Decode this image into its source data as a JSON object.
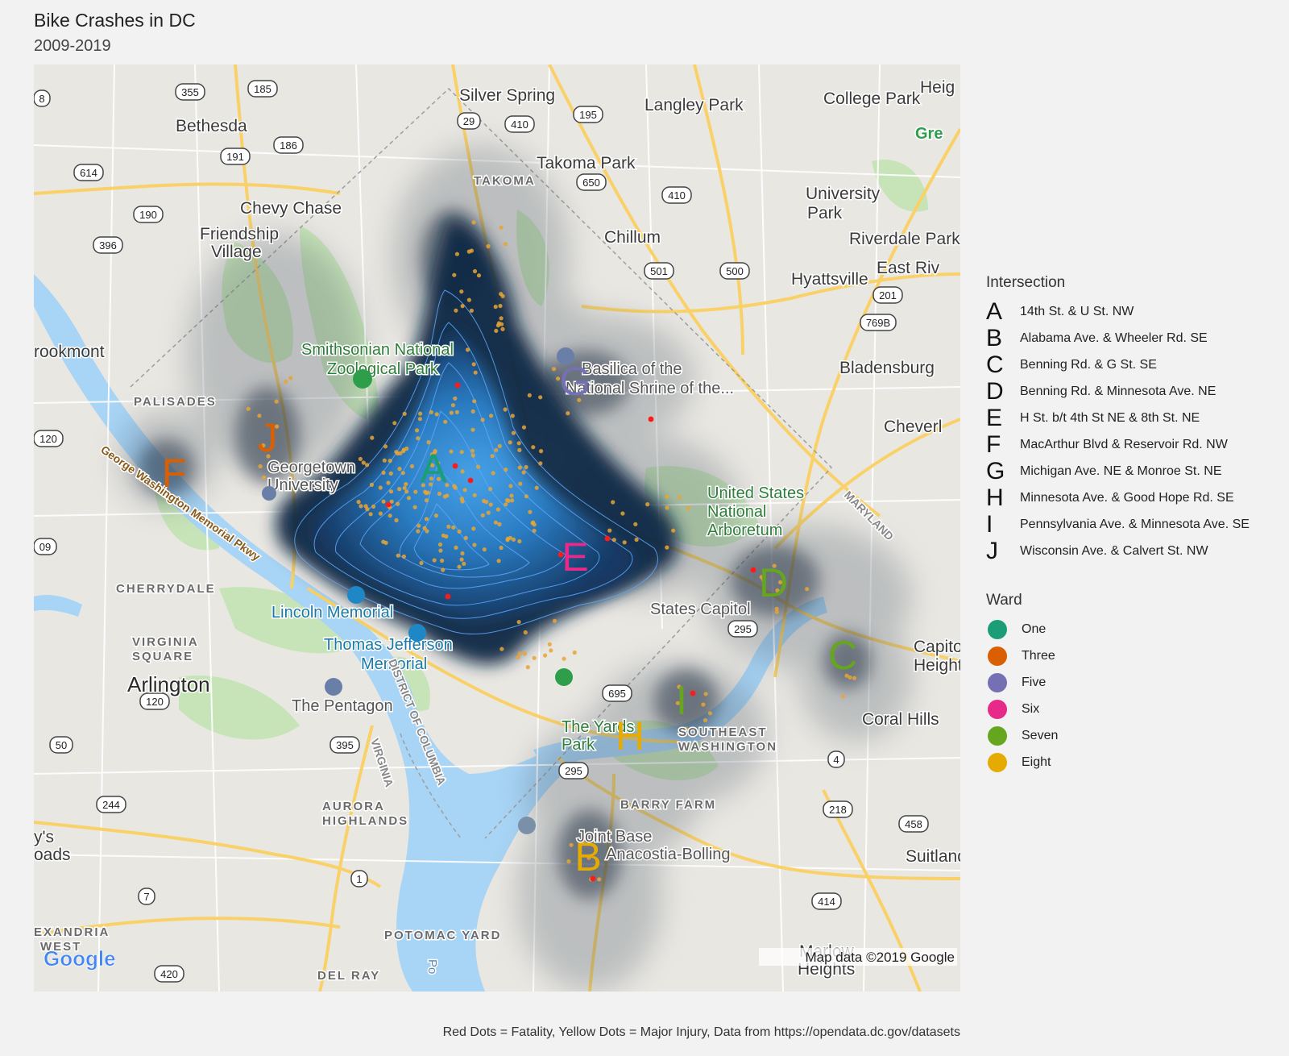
{
  "title": "Bike Crashes in DC",
  "subtitle": "2009-2019",
  "caption": "Red Dots = Fatality, Yellow Dots = Major Injury, Data from https://opendata.dc.gov/datasets",
  "map": {
    "copyright": "Map data ©2019 Google",
    "logo": "Google",
    "place_labels": [
      {
        "text": "Silver Spring",
        "kind": "city"
      },
      {
        "text": "Langley Park",
        "kind": "city"
      },
      {
        "text": "College Park",
        "kind": "city"
      },
      {
        "text": "Bethesda",
        "kind": "city"
      },
      {
        "text": "Takoma Park",
        "kind": "city"
      },
      {
        "text": "TAKOMA",
        "kind": "nbhd"
      },
      {
        "text": "Chevy Chase",
        "kind": "city"
      },
      {
        "text": "University",
        "kind": "city"
      },
      {
        "text": "Park",
        "kind": "city"
      },
      {
        "text": "Friendship",
        "kind": "city"
      },
      {
        "text": "Village",
        "kind": "city"
      },
      {
        "text": "Chillum",
        "kind": "city"
      },
      {
        "text": "Riverdale Park",
        "kind": "city"
      },
      {
        "text": "Hyattsville",
        "kind": "city"
      },
      {
        "text": "East Riv",
        "kind": "city"
      },
      {
        "text": "rookmont",
        "kind": "city"
      },
      {
        "text": "Smithsonian National",
        "kind": "park"
      },
      {
        "text": "Zoological Park",
        "kind": "park"
      },
      {
        "text": "Basilica of the",
        "kind": "poi"
      },
      {
        "text": "National Shrine of the...",
        "kind": "poi"
      },
      {
        "text": "Bladensburg",
        "kind": "city"
      },
      {
        "text": "PALISADES",
        "kind": "nbhd"
      },
      {
        "text": "Cheverl",
        "kind": "city"
      },
      {
        "text": "Georgetown",
        "kind": "poi"
      },
      {
        "text": "University",
        "kind": "poi"
      },
      {
        "text": "United States",
        "kind": "park"
      },
      {
        "text": "National",
        "kind": "park"
      },
      {
        "text": "Arboretum",
        "kind": "park"
      },
      {
        "text": "CHERRYDALE",
        "kind": "nbhd"
      },
      {
        "text": "Lincoln Memorial",
        "kind": "poiblue"
      },
      {
        "text": "States Capitol",
        "kind": "poi"
      },
      {
        "text": "Thomas Jefferson",
        "kind": "poiblue"
      },
      {
        "text": "Memorial",
        "kind": "poiblue"
      },
      {
        "text": "VIRGINIA",
        "kind": "nbhd"
      },
      {
        "text": "SQUARE",
        "kind": "nbhd"
      },
      {
        "text": "Arlington",
        "kind": "bigcity"
      },
      {
        "text": "Capitol",
        "kind": "city"
      },
      {
        "text": "Heights",
        "kind": "city"
      },
      {
        "text": "The Pentagon",
        "kind": "poi"
      },
      {
        "text": "Coral Hills",
        "kind": "city"
      },
      {
        "text": "The Yards",
        "kind": "park"
      },
      {
        "text": "Park",
        "kind": "park"
      },
      {
        "text": "SOUTHEAST",
        "kind": "nbhd"
      },
      {
        "text": "WASHINGTON",
        "kind": "nbhd"
      },
      {
        "text": "BARRY FARM",
        "kind": "nbhd"
      },
      {
        "text": "AURORA",
        "kind": "nbhd"
      },
      {
        "text": "HIGHLANDS",
        "kind": "nbhd"
      },
      {
        "text": "Joint Base",
        "kind": "poi"
      },
      {
        "text": "Anacostia-Bolling",
        "kind": "poi"
      },
      {
        "text": "Suitland-Silver H",
        "kind": "city"
      },
      {
        "text": "y's",
        "kind": "city"
      },
      {
        "text": "oads",
        "kind": "city"
      },
      {
        "text": "POTOMAC YARD",
        "kind": "nbhd"
      },
      {
        "text": "EXANDRIA",
        "kind": "nbhd"
      },
      {
        "text": "WEST",
        "kind": "nbhd"
      },
      {
        "text": "DEL RAY",
        "kind": "nbhd"
      },
      {
        "text": "Marlow",
        "kind": "city"
      },
      {
        "text": "Heights",
        "kind": "city"
      },
      {
        "text": "Heig",
        "kind": "city"
      },
      {
        "text": "Gre",
        "kind": "green"
      },
      {
        "text": "George Washington Memorial Pkwy",
        "kind": "road"
      },
      {
        "text": "DISTRICT OF COLUMBIA",
        "kind": "border"
      },
      {
        "text": "VIRGINIA",
        "kind": "border"
      },
      {
        "text": "MARYLAND",
        "kind": "border"
      },
      {
        "text": "Po",
        "kind": "water"
      }
    ],
    "route_shields": [
      "355",
      "185",
      "29",
      "410",
      "195",
      "191",
      "186",
      "614",
      "650",
      "410",
      "190",
      "396",
      "501",
      "500",
      "201",
      "769B",
      "120",
      "09",
      "295",
      "695",
      "120",
      "50",
      "395",
      "295",
      "244",
      "4",
      "218",
      "458",
      "1",
      "7",
      "414",
      "420",
      "8"
    ],
    "intersection_markers": [
      {
        "letter": "A",
        "color": "#1b9e77"
      },
      {
        "letter": "B",
        "color": "#e6ab02"
      },
      {
        "letter": "C",
        "color": "#66a61e"
      },
      {
        "letter": "D",
        "color": "#66a61e"
      },
      {
        "letter": "E",
        "color": "#e7298a"
      },
      {
        "letter": "F",
        "color": "#d95f02"
      },
      {
        "letter": "G",
        "color": "#7570b3"
      },
      {
        "letter": "H",
        "color": "#e6ab02"
      },
      {
        "letter": "I",
        "color": "#66a61e"
      },
      {
        "letter": "J",
        "color": "#d95f02"
      }
    ]
  },
  "legend_intersection": {
    "title": "Intersection",
    "items": [
      {
        "letter": "A",
        "label": "14th St. & U St. NW"
      },
      {
        "letter": "B",
        "label": "Alabama Ave. & Wheeler Rd. SE"
      },
      {
        "letter": "C",
        "label": "Benning Rd. & G St. SE"
      },
      {
        "letter": "D",
        "label": "Benning Rd. & Minnesota Ave. NE"
      },
      {
        "letter": "E",
        "label": "H St. b/t 4th St NE & 8th St. NE"
      },
      {
        "letter": "F",
        "label": "MacArthur Blvd & Reservoir Rd. NW"
      },
      {
        "letter": "G",
        "label": "Michigan Ave. NE & Monroe St. NE"
      },
      {
        "letter": "H",
        "label": "Minnesota Ave. & Good Hope Rd. SE"
      },
      {
        "letter": "I",
        "label": "Pennsylvania Ave. & Minnesota Ave. SE"
      },
      {
        "letter": "J",
        "label": "Wisconsin Ave. & Calvert St. NW"
      }
    ]
  },
  "legend_ward": {
    "title": "Ward",
    "items": [
      {
        "label": "One",
        "color": "#1b9e77"
      },
      {
        "label": "Three",
        "color": "#d95f02"
      },
      {
        "label": "Five",
        "color": "#7570b3"
      },
      {
        "label": "Six",
        "color": "#e7298a"
      },
      {
        "label": "Seven",
        "color": "#66a61e"
      },
      {
        "label": "Eight",
        "color": "#e6ab02"
      }
    ]
  }
}
